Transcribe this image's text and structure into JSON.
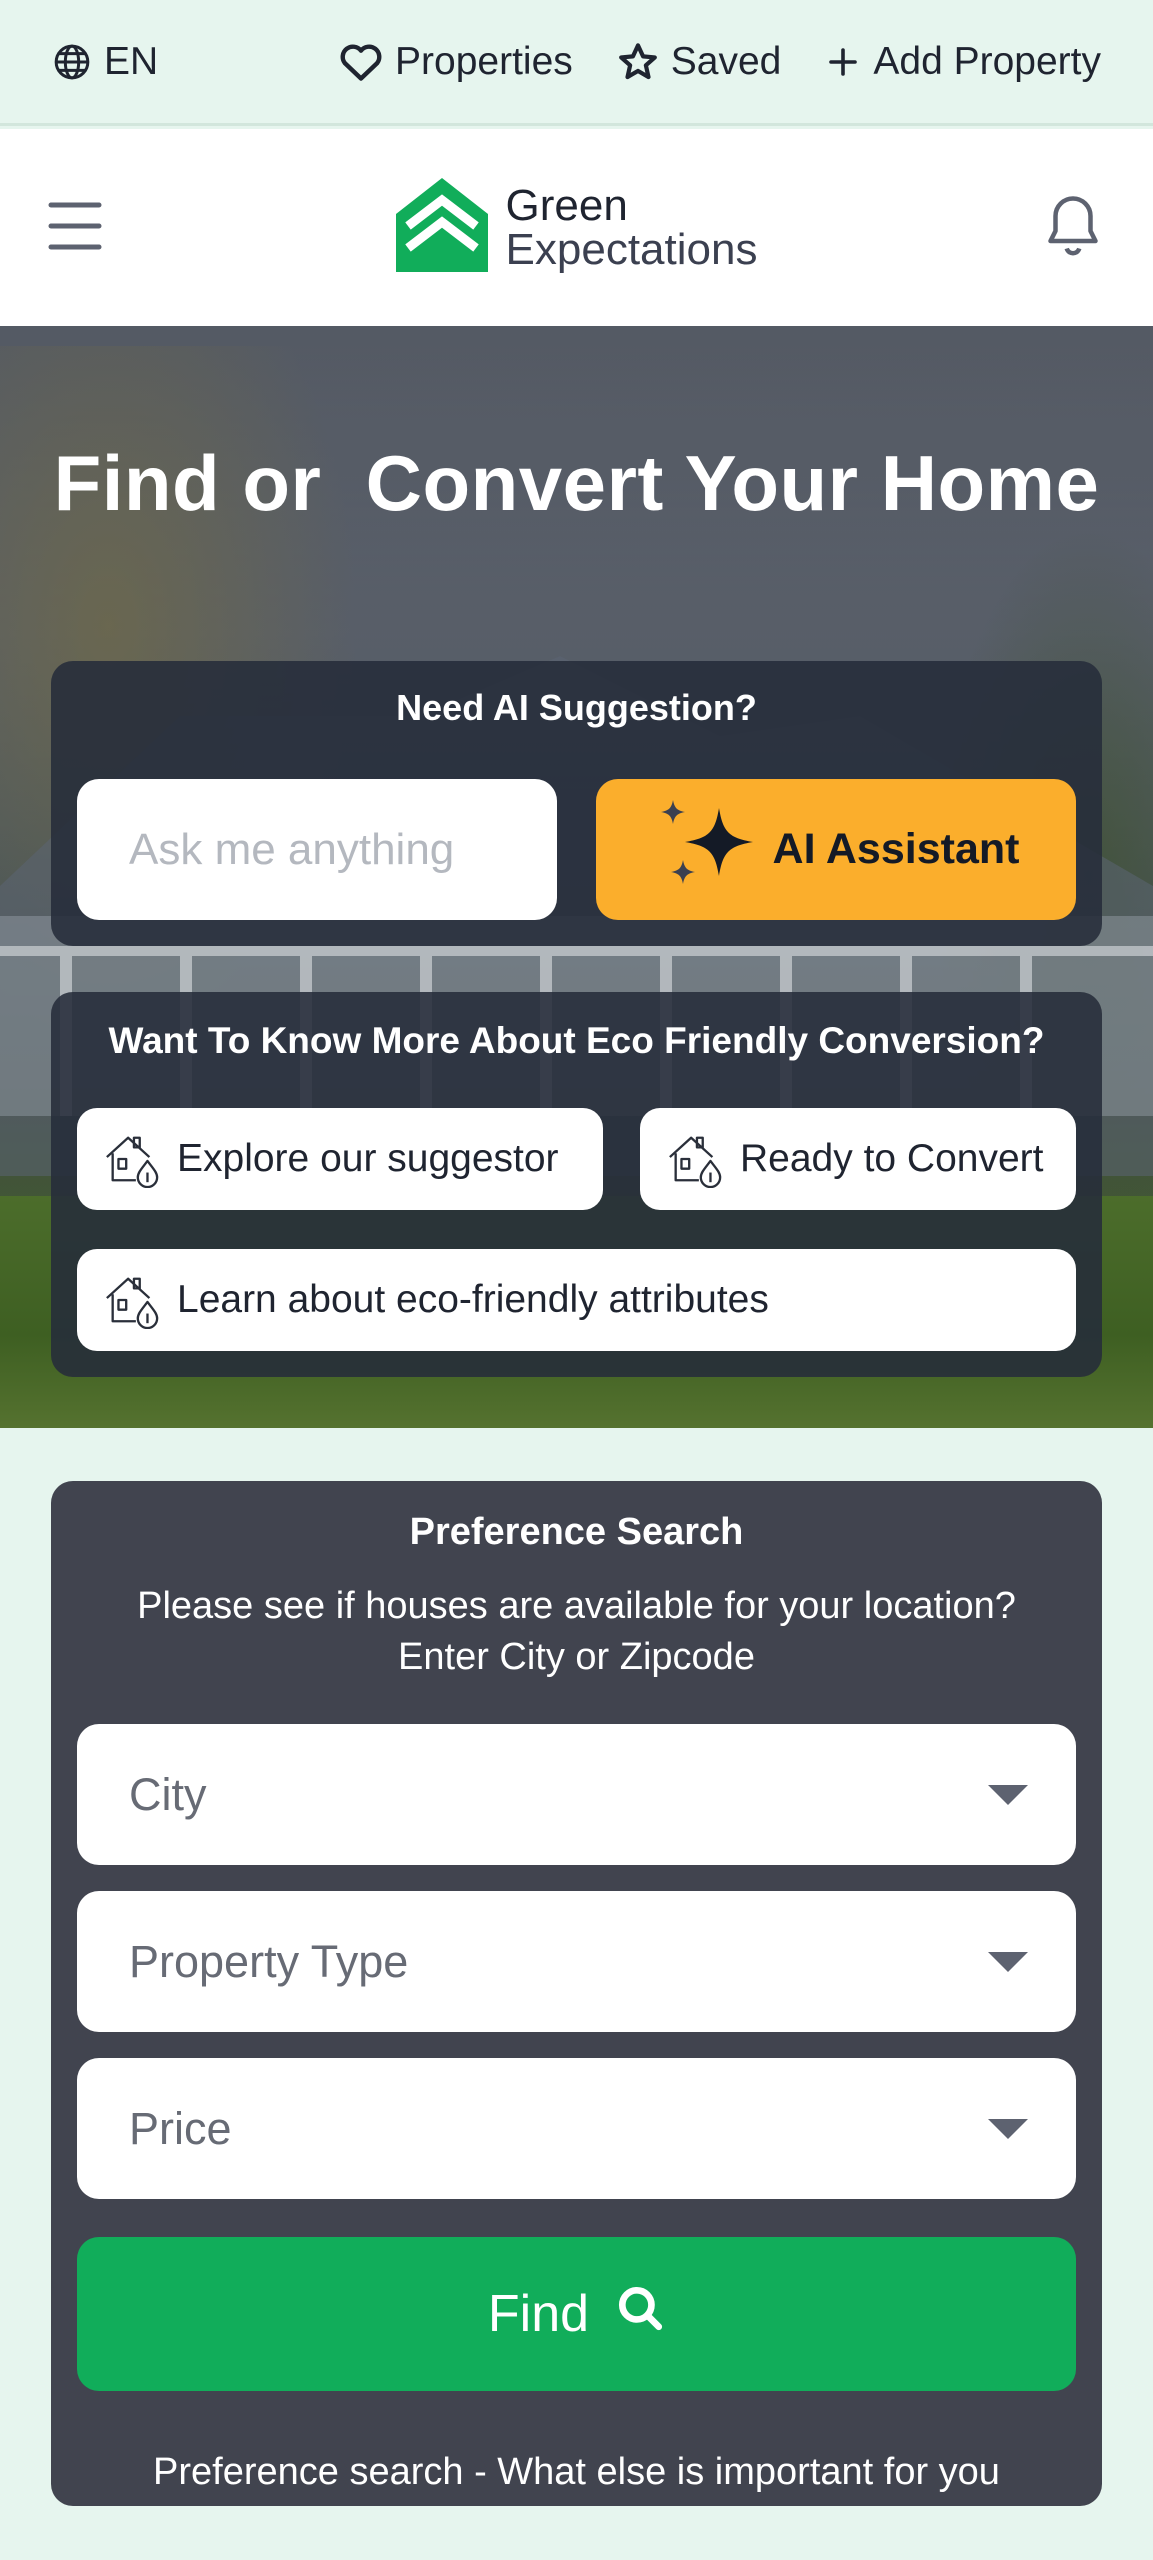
{
  "topbar": {
    "language": "EN",
    "properties": "Properties",
    "saved": "Saved",
    "add_property": "Add Property"
  },
  "header": {
    "logo_line1": "Green",
    "logo_line2": "Expectations",
    "brand_color": "#11ad5a"
  },
  "hero": {
    "title": "Find or  Convert Your Home",
    "ai_heading": "Need AI Suggestion?",
    "ask_placeholder": "Ask me anything",
    "ai_button": "AI Assistant",
    "eco_heading": "Want To Know More About Eco Friendly Conversion?",
    "eco_buttons": [
      "Explore our suggestor",
      "Ready to Convert",
      "Learn about eco-friendly attributes"
    ]
  },
  "preference": {
    "title": "Preference Search",
    "description": "Please see if houses are available for your location? Enter City or Zipcode",
    "city": "City",
    "property_type": "Property Type",
    "price": "Price",
    "find_button": "Find",
    "footer": "Preference search - What else is important for you"
  },
  "colors": {
    "accent": "#fbae2c",
    "primary": "#11ad5a",
    "card": "#41444f"
  }
}
